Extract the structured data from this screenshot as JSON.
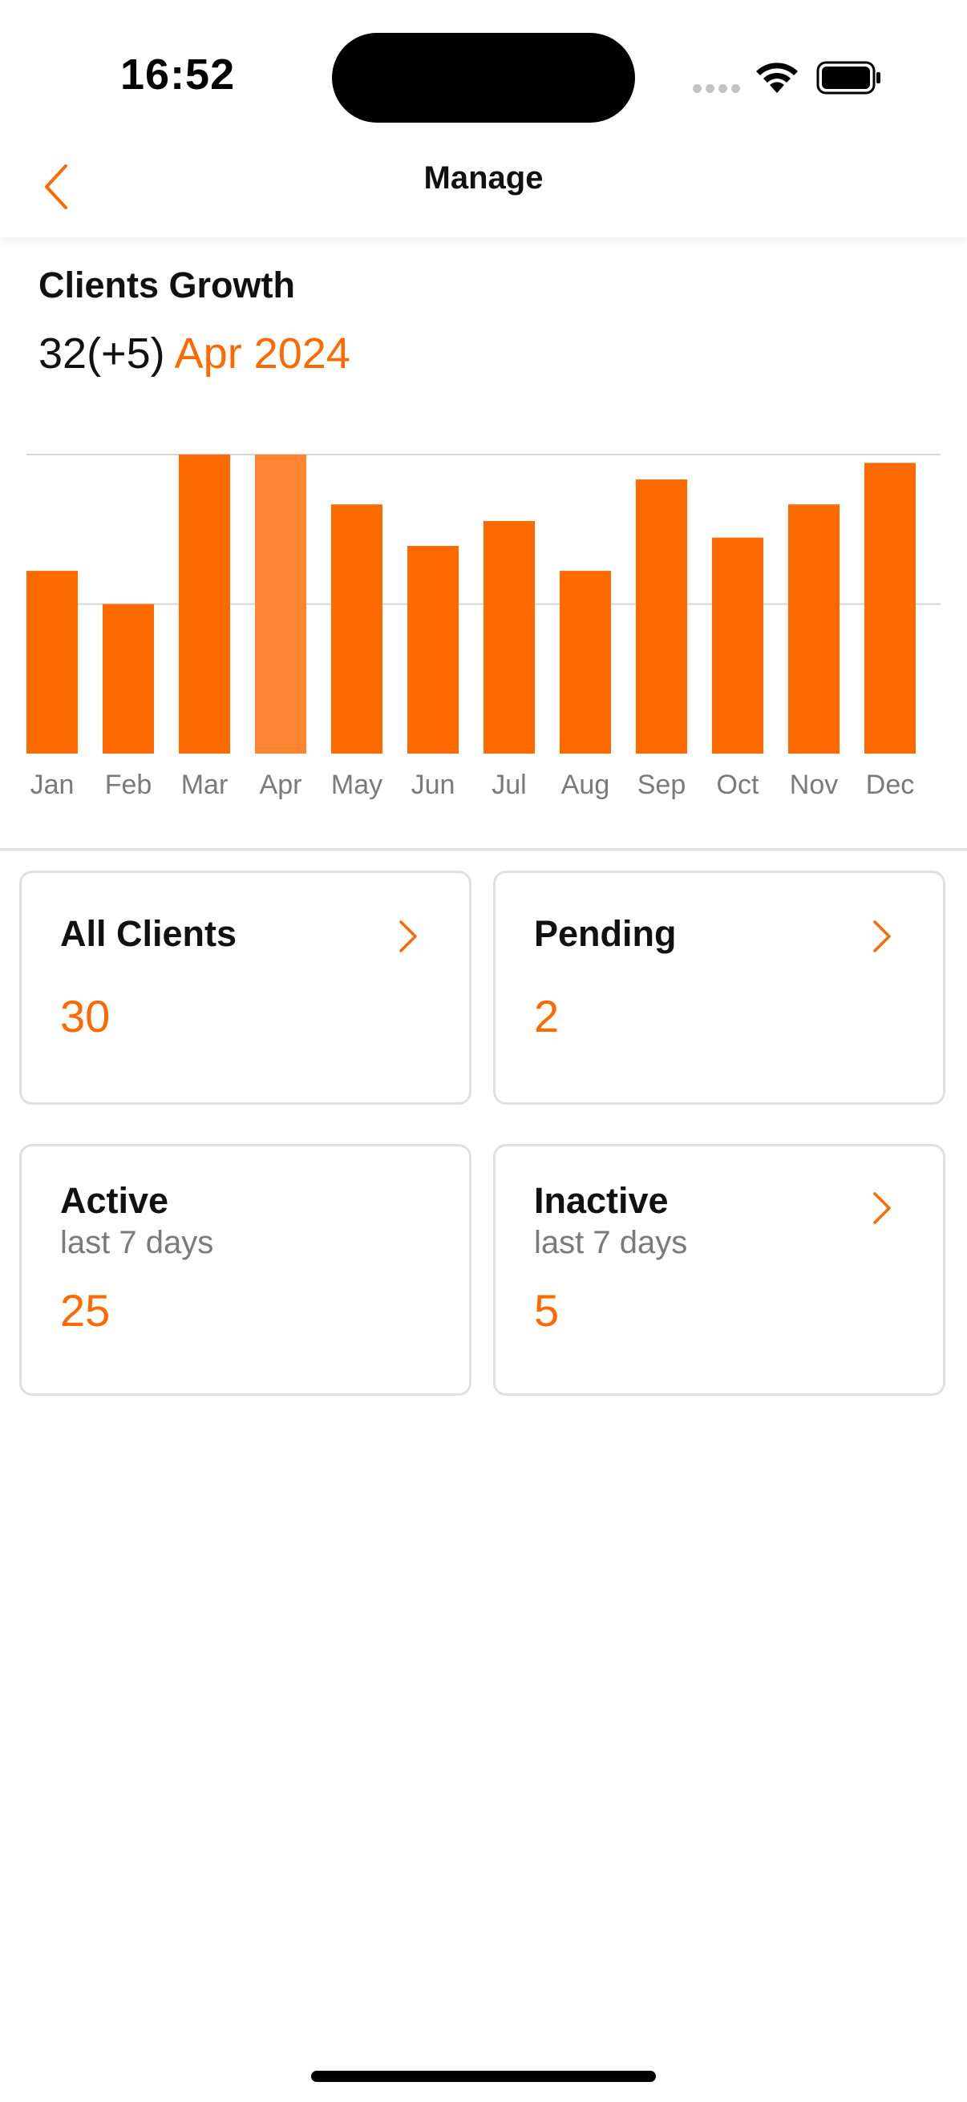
{
  "status_bar": {
    "time": "16:52"
  },
  "nav": {
    "title": "Manage",
    "back_icon": "chevron-left-icon"
  },
  "growth": {
    "title": "Clients Growth",
    "value": "32(+5)",
    "period": "Apr 2024"
  },
  "chart_data": {
    "type": "bar",
    "categories": [
      "Jan",
      "Feb",
      "Mar",
      "Apr",
      "May",
      "Jun",
      "Jul",
      "Aug",
      "Sep",
      "Oct",
      "Nov",
      "Dec"
    ],
    "values": [
      22,
      18,
      36,
      36,
      30,
      25,
      28,
      22,
      33,
      26,
      30,
      35
    ],
    "highlighted_category": "Apr",
    "ylim": [
      0,
      36
    ],
    "grid": true,
    "colors": {
      "bar": "#ff6a00",
      "highlight": "#ff8533"
    }
  },
  "cards": {
    "all_clients": {
      "title": "All Clients",
      "value": "30",
      "icon": "chevron-right-icon"
    },
    "pending": {
      "title": "Pending",
      "value": "2",
      "icon": "chevron-right-icon"
    },
    "active": {
      "title": "Active",
      "subtitle": "last 7 days",
      "value": "25"
    },
    "inactive": {
      "title": "Inactive",
      "subtitle": "last 7 days",
      "value": "5",
      "icon": "chevron-right-icon"
    }
  },
  "colors": {
    "accent": "#ff6a00"
  }
}
